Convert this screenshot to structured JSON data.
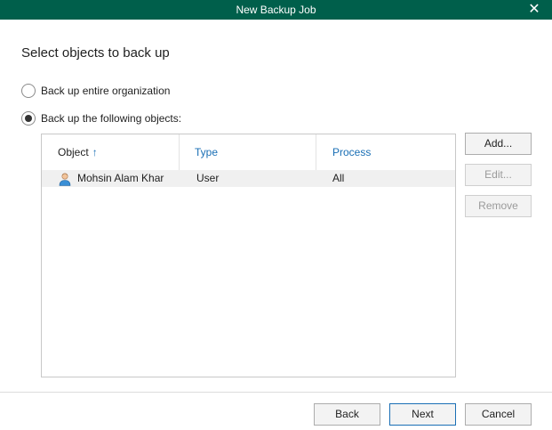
{
  "window": {
    "title": "New Backup Job",
    "close_glyph": "✕"
  },
  "page": {
    "heading": "Select objects to back up"
  },
  "options": {
    "entire_org_label": "Back up entire organization",
    "entire_org_checked": false,
    "following_objects_label": "Back up the following objects:",
    "following_objects_checked": true
  },
  "grid": {
    "columns": [
      {
        "label": "Object",
        "sort": "ascending",
        "sort_glyph": "↑"
      },
      {
        "label": "Type"
      },
      {
        "label": "Process"
      }
    ],
    "rows": [
      {
        "object": "Mohsin Alam Khar",
        "type": "User",
        "process": "All",
        "icon": "user-icon"
      }
    ]
  },
  "side_buttons": {
    "add": "Add...",
    "edit": "Edit...",
    "remove": "Remove"
  },
  "footer": {
    "back": "Back",
    "next": "Next",
    "cancel": "Cancel"
  },
  "colors": {
    "titlebar": "#005f4b",
    "header_link": "#1a6fb5",
    "selected_row": "#f0f0f0"
  }
}
